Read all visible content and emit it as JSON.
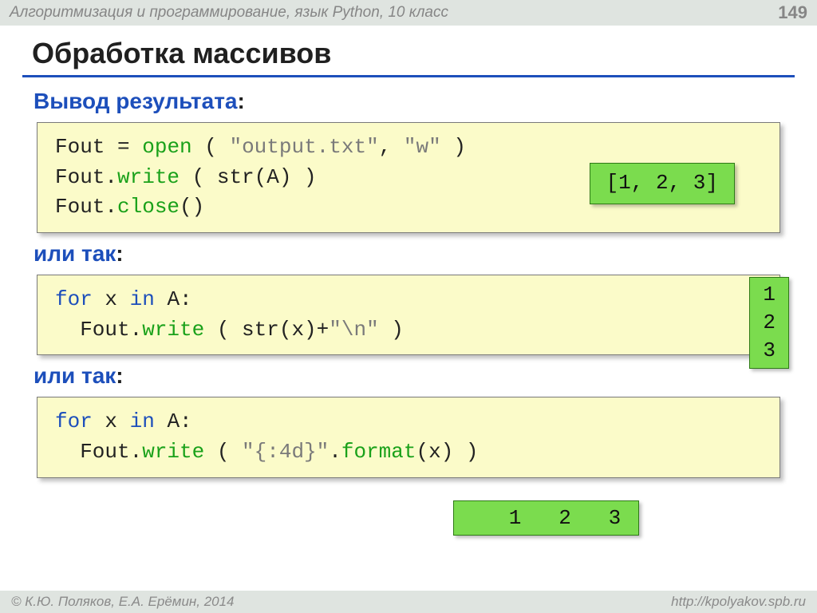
{
  "header": {
    "breadcrumb": "Алгоритмизация и программирование, язык Python, 10 класс",
    "page_number": "149"
  },
  "title": "Обработка массивов",
  "section1": {
    "heading": "Вывод результата",
    "colon": ":",
    "code": {
      "l1a": "Fout",
      "l1b": " = ",
      "l1fn": "open",
      "l1c": " ( ",
      "l1s1": "\"output.txt\"",
      "l1d": ", ",
      "l1s2": "\"w\"",
      "l1e": " )",
      "l2a": "Fout.",
      "l2fn": "write",
      "l2b": " ( str(A) )",
      "l3a": "Fout.",
      "l3fn": "close",
      "l3b": "()"
    },
    "output": "[1, 2, 3]"
  },
  "section2": {
    "heading": "или так",
    "colon": ":",
    "code": {
      "l1kw1": "for",
      "l1a": " x ",
      "l1kw2": "in",
      "l1b": " A:",
      "l2a": "  Fout.",
      "l2fn": "write",
      "l2b": " ( str(x)+",
      "l2s": "\"\\n\"",
      "l2c": " )"
    },
    "output": "1\n2\n3"
  },
  "section3": {
    "heading": "или так",
    "colon": ":",
    "code": {
      "l1kw1": "for",
      "l1a": " x ",
      "l1kw2": "in",
      "l1b": " A:",
      "l2a": "  Fout.",
      "l2fn": "write",
      "l2b": " ( ",
      "l2s": "\"{:4d}\"",
      "l2c": ".",
      "l2fn2": "format",
      "l2d": "(x) )"
    },
    "output": "   1   2   3"
  },
  "footer": {
    "copyright": "© К.Ю. Поляков, Е.А. Ерёмин, 2014",
    "url": "http://kpolyakov.spb.ru"
  }
}
